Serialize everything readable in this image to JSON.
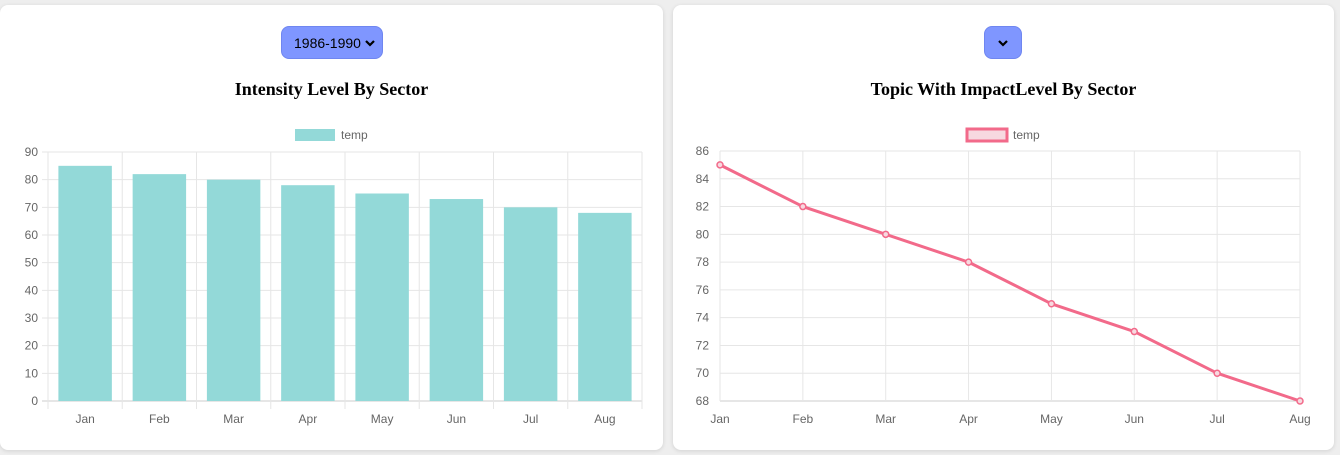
{
  "left_panel": {
    "year_select": "1986-1990",
    "title": "Intensity Level By Sector"
  },
  "right_panel": {
    "year_select": "",
    "title": "Topic With ImpactLevel By Sector"
  },
  "icons": {
    "dropdown": "chevron-down-icon"
  },
  "colors": {
    "select_bg": "#7f96ff",
    "bar_fill": "#93d9d8",
    "line_stroke": "#f26a8a",
    "line_point_fill": "#f7d9e0"
  },
  "chart_data": [
    {
      "type": "bar",
      "categories": [
        "Jan",
        "Feb",
        "Mar",
        "Apr",
        "May",
        "Jun",
        "Jul",
        "Aug"
      ],
      "series": [
        {
          "name": "temp",
          "values": [
            85,
            82,
            80,
            78,
            75,
            73,
            70,
            68
          ]
        }
      ],
      "title": "Intensity Level By Sector",
      "ylim": [
        0,
        90
      ],
      "yticks": [
        "0",
        "10",
        "20",
        "30",
        "40",
        "50",
        "60",
        "70",
        "80",
        "90"
      ],
      "grid": true,
      "legend": "top-center"
    },
    {
      "type": "line",
      "categories": [
        "Jan",
        "Feb",
        "Mar",
        "Apr",
        "May",
        "Jun",
        "Jul",
        "Aug"
      ],
      "series": [
        {
          "name": "temp",
          "values": [
            85,
            82,
            80,
            78,
            75,
            73,
            70,
            68
          ]
        }
      ],
      "title": "Topic With ImpactLevel By Sector",
      "ylim": [
        68,
        86
      ],
      "yticks": [
        "68",
        "70",
        "72",
        "74",
        "76",
        "78",
        "80",
        "82",
        "84",
        "86"
      ],
      "grid": true,
      "legend": "top-center"
    }
  ]
}
